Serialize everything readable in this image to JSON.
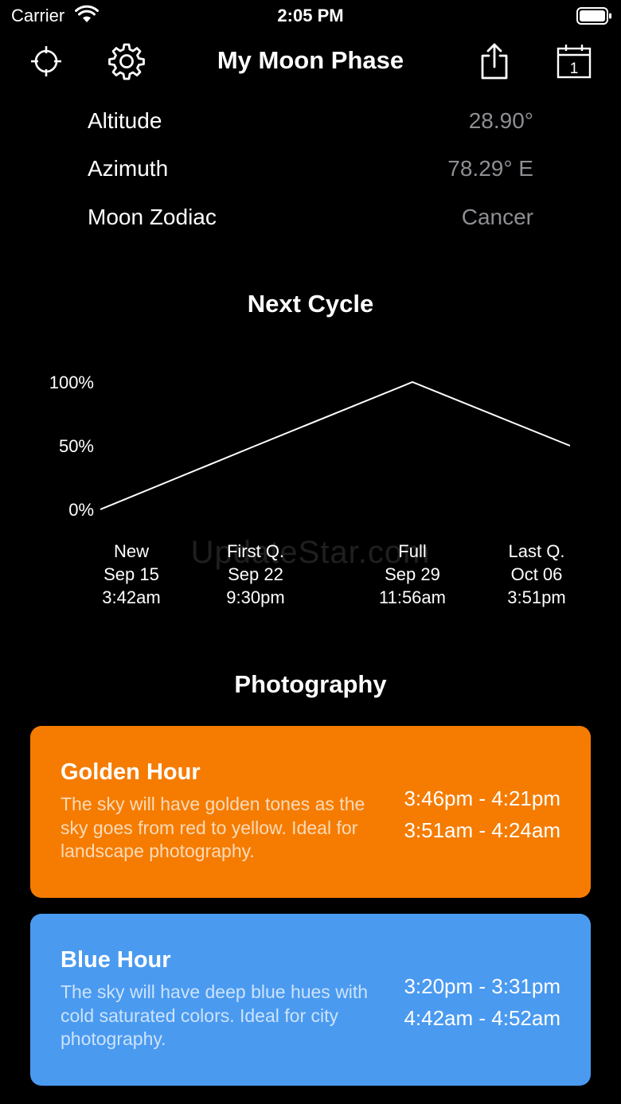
{
  "status_bar": {
    "carrier": "Carrier",
    "time": "2:05 PM"
  },
  "nav": {
    "title": "My Moon Phase"
  },
  "info_rows": [
    {
      "label": "Altitude",
      "value": "28.90°"
    },
    {
      "label": "Azimuth",
      "value": "78.29° E"
    },
    {
      "label": "Moon Zodiac",
      "value": "Cancer"
    }
  ],
  "next_cycle": {
    "title": "Next Cycle",
    "phases": [
      {
        "name": "New",
        "date": "Sep 15",
        "time": "3:42am"
      },
      {
        "name": "First Q.",
        "date": "Sep 22",
        "time": "9:30pm"
      },
      {
        "name": "Full",
        "date": "Sep 29",
        "time": "11:56am"
      },
      {
        "name": "Last Q.",
        "date": "Oct 06",
        "time": "3:51pm"
      }
    ]
  },
  "chart_data": {
    "type": "line",
    "title": "",
    "xlabel": "",
    "ylabel": "",
    "y_ticks": [
      "100%",
      "50%",
      "0%"
    ],
    "ylim": [
      0,
      100
    ],
    "categories": [
      "New",
      "First Q.",
      "Full",
      "Last Q."
    ],
    "values": [
      0,
      50,
      100,
      50
    ],
    "grid": false
  },
  "watermark": "UpdateStar.com",
  "photography": {
    "title": "Photography",
    "cards": [
      {
        "title": "Golden Hour",
        "description": "The sky will have golden tones as the sky goes from red to yellow. Ideal for landscape photography.",
        "time_evening": "3:46pm - 4:21pm",
        "time_morning": "3:51am - 4:24am",
        "color": "#f57c00"
      },
      {
        "title": "Blue Hour",
        "description": "The sky will have deep blue hues with cold saturated colors. Ideal for city photography.",
        "time_evening": "3:20pm - 3:31pm",
        "time_morning": "4:42am - 4:52am",
        "color": "#4a9af0"
      }
    ]
  }
}
